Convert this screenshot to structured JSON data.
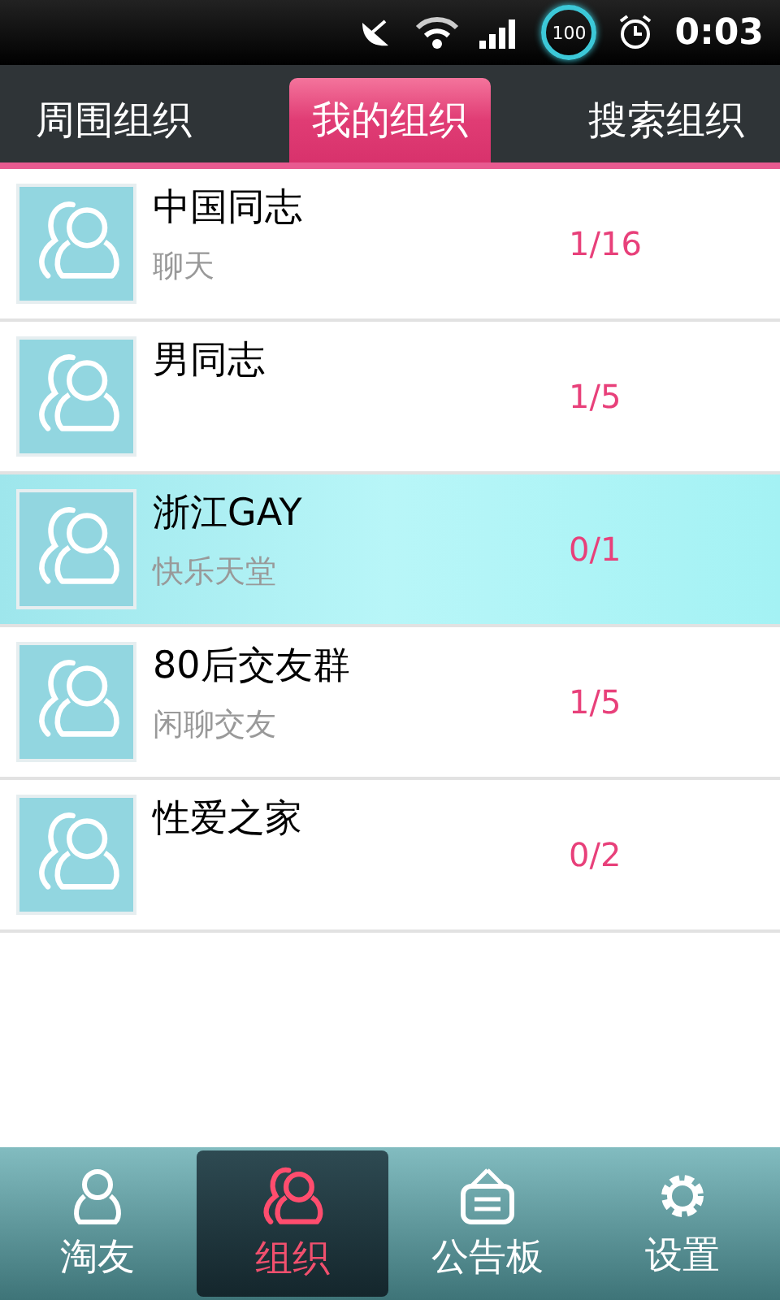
{
  "status_bar": {
    "battery": "100",
    "time": "0:03"
  },
  "tabs": [
    {
      "label": "周围组织",
      "selected": false
    },
    {
      "label": "我的组织",
      "selected": true
    },
    {
      "label": "搜索组织",
      "selected": false
    }
  ],
  "groups": [
    {
      "name": "中国同志",
      "subtitle": "聊天",
      "count": "1/16",
      "selected": false
    },
    {
      "name": "男同志",
      "count": "1/5",
      "selected": false
    },
    {
      "name": "浙江GAY",
      "subtitle": "快乐天堂",
      "count": "0/1",
      "selected": true
    },
    {
      "name": "80后交友群",
      "subtitle": "闲聊交友",
      "count": "1/5",
      "selected": false
    },
    {
      "name": "性爱之家",
      "count": "0/2",
      "selected": false
    }
  ],
  "bottom_nav": [
    {
      "label": "淘友",
      "kind": "person",
      "selected": false
    },
    {
      "label": "组织",
      "kind": "group",
      "selected": true
    },
    {
      "label": "公告板",
      "kind": "board",
      "selected": false
    },
    {
      "label": "设置",
      "kind": "settings",
      "selected": false
    }
  ]
}
